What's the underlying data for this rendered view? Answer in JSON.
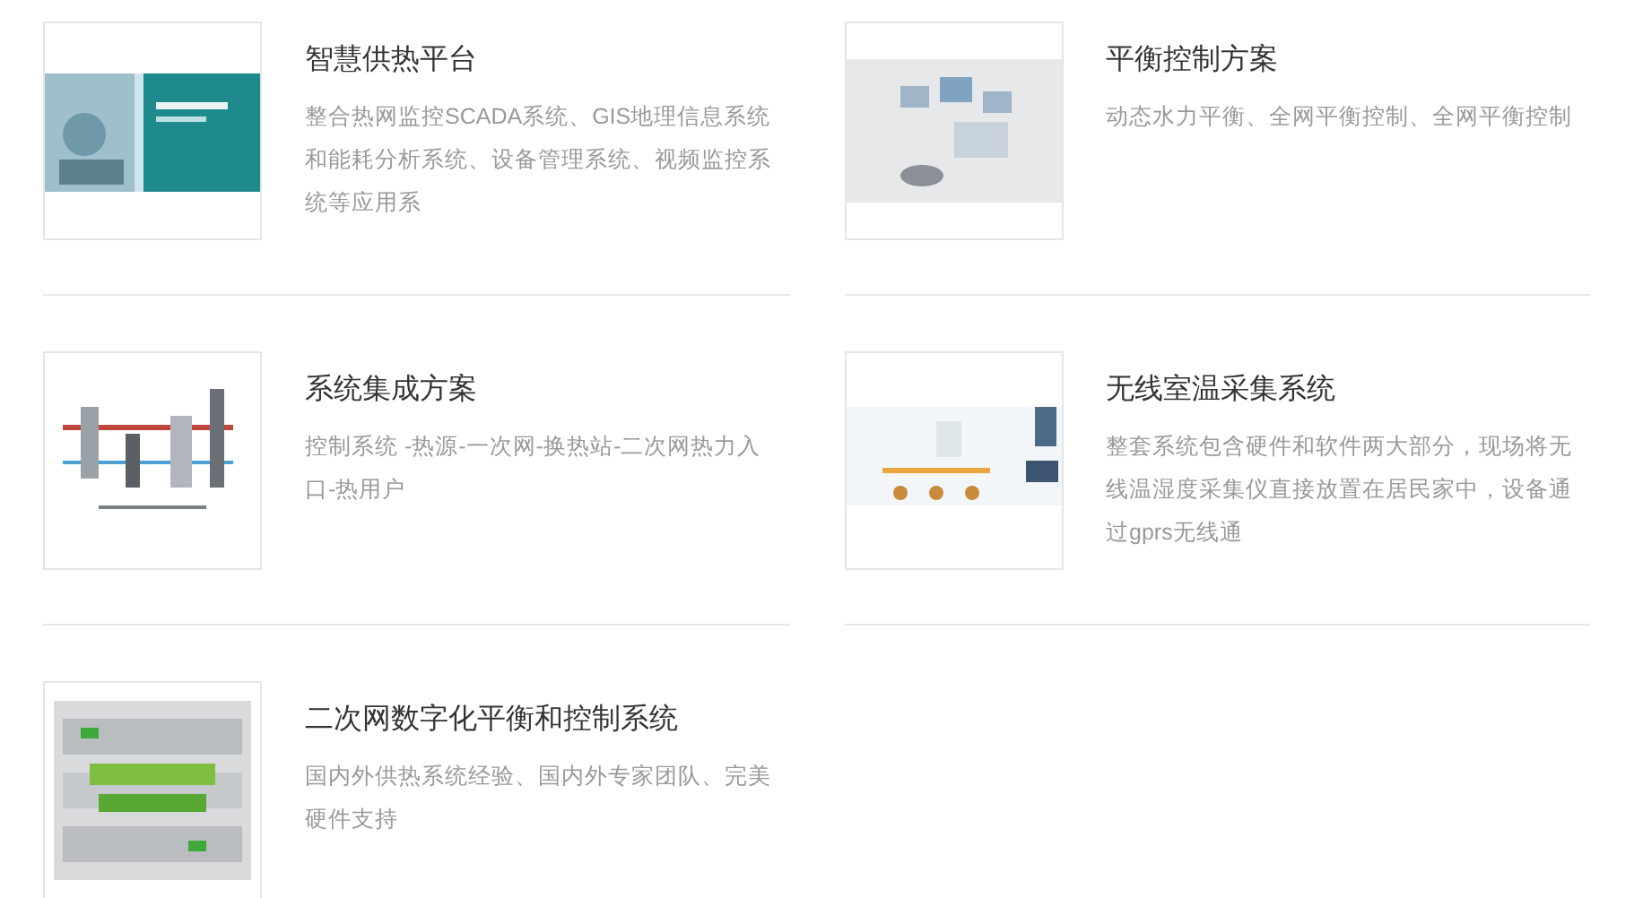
{
  "products": [
    {
      "title": "智慧供热平台",
      "description": "整合热网监控SCADA系统、GIS地理信息系统和能耗分析系统、设备管理系统、视频监控系统等应用系"
    },
    {
      "title": "平衡控制方案",
      "description": "动态水力平衡、全网平衡控制、全网平衡控制"
    },
    {
      "title": "系统集成方案",
      "description": "控制系统 -热源-一次网-换热站-二次网热力入口-热用户"
    },
    {
      "title": "无线室温采集系统",
      "description": "整套系统包含硬件和软件两大部分，现场将无线温湿度采集仪直接放置在居民家中，设备通过gprs无线通"
    },
    {
      "title": "二次网数字化平衡和控制系统",
      "description": "国内外供热系统经验、国内外专家团队、完美硬件支持"
    }
  ]
}
